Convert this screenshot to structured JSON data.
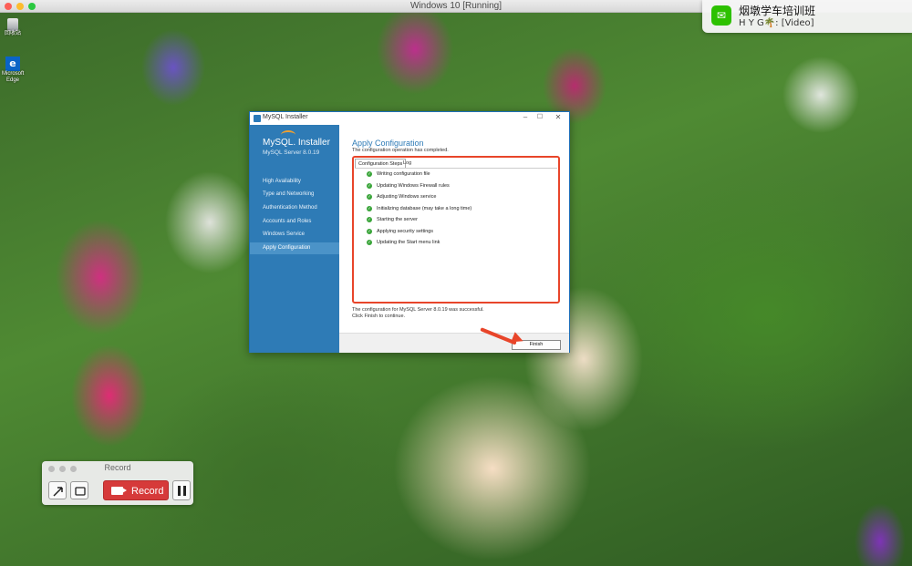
{
  "mac_window": {
    "title": "Windows 10 [Running]"
  },
  "desktop": {
    "icons": [
      {
        "label": "回收站",
        "icon": "recycle-bin-icon"
      },
      {
        "label": "Microsoft Edge",
        "icon": "edge-icon"
      }
    ]
  },
  "notification": {
    "app": "WeChat",
    "title": "烟墩学车培训班",
    "body": "H Y G🌴: [Video]"
  },
  "installer": {
    "window_title": "MySQL Installer",
    "product_logo": "MySQL. Installer",
    "product_version": "MySQL Server 8.0.19",
    "sidebar_items": [
      {
        "label": "High Availability",
        "active": false
      },
      {
        "label": "Type and Networking",
        "active": false
      },
      {
        "label": "Authentication Method",
        "active": false
      },
      {
        "label": "Accounts and Roles",
        "active": false
      },
      {
        "label": "Windows Service",
        "active": false
      },
      {
        "label": "Apply Configuration",
        "active": true
      }
    ],
    "heading": "Apply Configuration",
    "subheading": "The configuration operation has completed.",
    "tabs": [
      "Configuration Steps",
      "Log"
    ],
    "steps": [
      "Writing configuration file",
      "Updating Windows Firewall rules",
      "Adjusting Windows service",
      "Initializing database (may take a long time)",
      "Starting the server",
      "Applying security settings",
      "Updating the Start menu link"
    ],
    "result_line1": "The configuration for MySQL Server 8.0.19 was successful.",
    "result_line2": "Click Finish to continue.",
    "finish_label": "Finish"
  },
  "recorder": {
    "title": "Record",
    "record_label": "Record"
  },
  "colors": {
    "sidebar": "#2e7bb6",
    "highlight": "#e8452a",
    "record_button": "#d63a3a",
    "check": "#3aa53a"
  }
}
